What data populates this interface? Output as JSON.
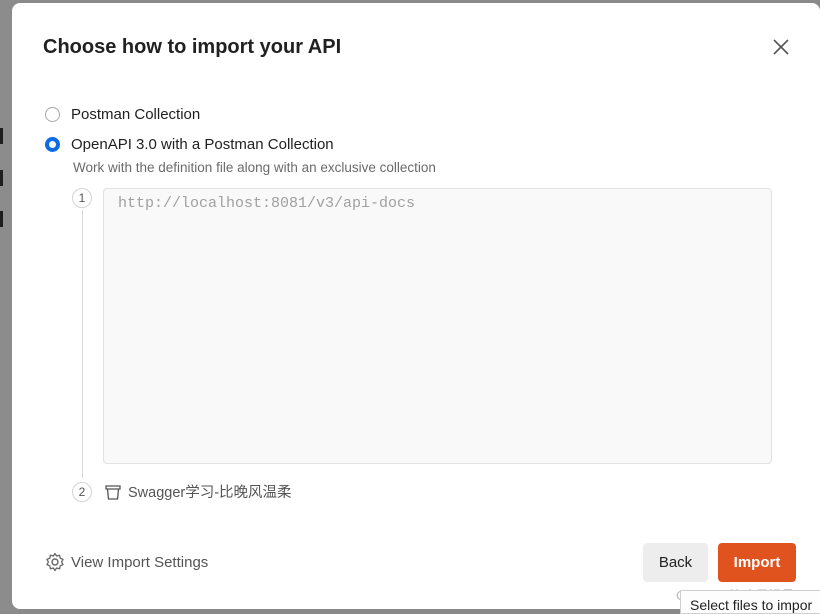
{
  "modal": {
    "title": "Choose how to import your API",
    "options": [
      {
        "label": "Postman Collection",
        "selected": false
      },
      {
        "label": "OpenAPI 3.0 with a Postman Collection",
        "selected": true,
        "description": "Work with the definition file along with an exclusive collection"
      }
    ],
    "steps": [
      "1",
      "2"
    ],
    "url_input": {
      "value": "",
      "placeholder": "http://localhost:8081/v3/api-docs"
    },
    "collection_name": "Swagger学习-比晚风温柔",
    "settings_link": "View Import Settings",
    "back_label": "Back",
    "import_label": "Import"
  },
  "colors": {
    "accent": "#e0531f",
    "radio": "#0b6ce3"
  },
  "watermark": "CSDN @比晚风温柔",
  "tooltip": "Select files to impor"
}
